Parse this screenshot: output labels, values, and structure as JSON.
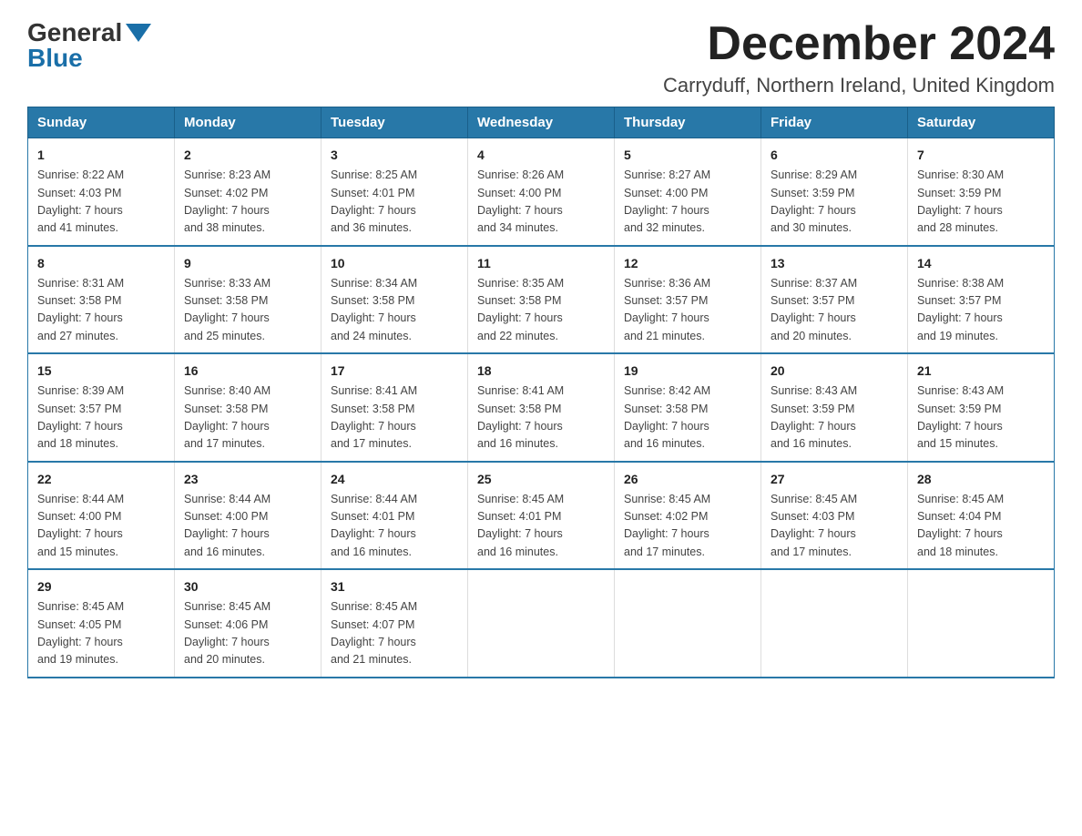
{
  "header": {
    "logo_general": "General",
    "logo_blue": "Blue",
    "month_title": "December 2024",
    "location": "Carryduff, Northern Ireland, United Kingdom"
  },
  "weekdays": [
    "Sunday",
    "Monday",
    "Tuesday",
    "Wednesday",
    "Thursday",
    "Friday",
    "Saturday"
  ],
  "weeks": [
    [
      {
        "day": "1",
        "sunrise": "8:22 AM",
        "sunset": "4:03 PM",
        "daylight": "7 hours and 41 minutes."
      },
      {
        "day": "2",
        "sunrise": "8:23 AM",
        "sunset": "4:02 PM",
        "daylight": "7 hours and 38 minutes."
      },
      {
        "day": "3",
        "sunrise": "8:25 AM",
        "sunset": "4:01 PM",
        "daylight": "7 hours and 36 minutes."
      },
      {
        "day": "4",
        "sunrise": "8:26 AM",
        "sunset": "4:00 PM",
        "daylight": "7 hours and 34 minutes."
      },
      {
        "day": "5",
        "sunrise": "8:27 AM",
        "sunset": "4:00 PM",
        "daylight": "7 hours and 32 minutes."
      },
      {
        "day": "6",
        "sunrise": "8:29 AM",
        "sunset": "3:59 PM",
        "daylight": "7 hours and 30 minutes."
      },
      {
        "day": "7",
        "sunrise": "8:30 AM",
        "sunset": "3:59 PM",
        "daylight": "7 hours and 28 minutes."
      }
    ],
    [
      {
        "day": "8",
        "sunrise": "8:31 AM",
        "sunset": "3:58 PM",
        "daylight": "7 hours and 27 minutes."
      },
      {
        "day": "9",
        "sunrise": "8:33 AM",
        "sunset": "3:58 PM",
        "daylight": "7 hours and 25 minutes."
      },
      {
        "day": "10",
        "sunrise": "8:34 AM",
        "sunset": "3:58 PM",
        "daylight": "7 hours and 24 minutes."
      },
      {
        "day": "11",
        "sunrise": "8:35 AM",
        "sunset": "3:58 PM",
        "daylight": "7 hours and 22 minutes."
      },
      {
        "day": "12",
        "sunrise": "8:36 AM",
        "sunset": "3:57 PM",
        "daylight": "7 hours and 21 minutes."
      },
      {
        "day": "13",
        "sunrise": "8:37 AM",
        "sunset": "3:57 PM",
        "daylight": "7 hours and 20 minutes."
      },
      {
        "day": "14",
        "sunrise": "8:38 AM",
        "sunset": "3:57 PM",
        "daylight": "7 hours and 19 minutes."
      }
    ],
    [
      {
        "day": "15",
        "sunrise": "8:39 AM",
        "sunset": "3:57 PM",
        "daylight": "7 hours and 18 minutes."
      },
      {
        "day": "16",
        "sunrise": "8:40 AM",
        "sunset": "3:58 PM",
        "daylight": "7 hours and 17 minutes."
      },
      {
        "day": "17",
        "sunrise": "8:41 AM",
        "sunset": "3:58 PM",
        "daylight": "7 hours and 17 minutes."
      },
      {
        "day": "18",
        "sunrise": "8:41 AM",
        "sunset": "3:58 PM",
        "daylight": "7 hours and 16 minutes."
      },
      {
        "day": "19",
        "sunrise": "8:42 AM",
        "sunset": "3:58 PM",
        "daylight": "7 hours and 16 minutes."
      },
      {
        "day": "20",
        "sunrise": "8:43 AM",
        "sunset": "3:59 PM",
        "daylight": "7 hours and 16 minutes."
      },
      {
        "day": "21",
        "sunrise": "8:43 AM",
        "sunset": "3:59 PM",
        "daylight": "7 hours and 15 minutes."
      }
    ],
    [
      {
        "day": "22",
        "sunrise": "8:44 AM",
        "sunset": "4:00 PM",
        "daylight": "7 hours and 15 minutes."
      },
      {
        "day": "23",
        "sunrise": "8:44 AM",
        "sunset": "4:00 PM",
        "daylight": "7 hours and 16 minutes."
      },
      {
        "day": "24",
        "sunrise": "8:44 AM",
        "sunset": "4:01 PM",
        "daylight": "7 hours and 16 minutes."
      },
      {
        "day": "25",
        "sunrise": "8:45 AM",
        "sunset": "4:01 PM",
        "daylight": "7 hours and 16 minutes."
      },
      {
        "day": "26",
        "sunrise": "8:45 AM",
        "sunset": "4:02 PM",
        "daylight": "7 hours and 17 minutes."
      },
      {
        "day": "27",
        "sunrise": "8:45 AM",
        "sunset": "4:03 PM",
        "daylight": "7 hours and 17 minutes."
      },
      {
        "day": "28",
        "sunrise": "8:45 AM",
        "sunset": "4:04 PM",
        "daylight": "7 hours and 18 minutes."
      }
    ],
    [
      {
        "day": "29",
        "sunrise": "8:45 AM",
        "sunset": "4:05 PM",
        "daylight": "7 hours and 19 minutes."
      },
      {
        "day": "30",
        "sunrise": "8:45 AM",
        "sunset": "4:06 PM",
        "daylight": "7 hours and 20 minutes."
      },
      {
        "day": "31",
        "sunrise": "8:45 AM",
        "sunset": "4:07 PM",
        "daylight": "7 hours and 21 minutes."
      },
      null,
      null,
      null,
      null
    ]
  ],
  "labels": {
    "sunrise": "Sunrise:",
    "sunset": "Sunset:",
    "daylight": "Daylight:"
  }
}
